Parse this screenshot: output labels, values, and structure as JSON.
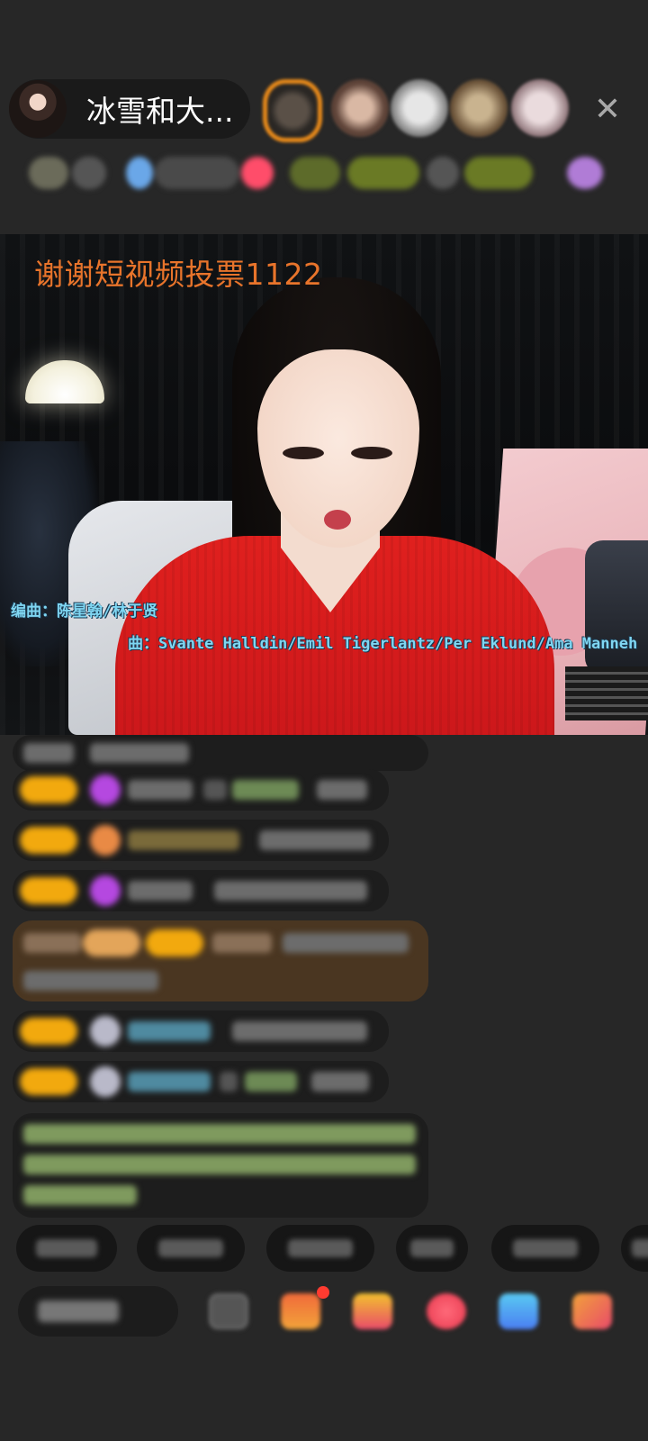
{
  "header": {
    "host_name": "冰雪和大...",
    "close_icon": "close-icon",
    "viewer_count_visible": 5
  },
  "video": {
    "overlay_title": "谢谢短视频投票1122",
    "lyric_line_1": "编曲：陈星翰/林于贤",
    "lyric_line_2": "曲：Svante Halldin/Emil Tigerlantz/Per Eklund/Ama Manneh"
  },
  "chat": {
    "messages_count": 9
  },
  "actions": {
    "quick_chips_count": 6,
    "bottom_icons": [
      "emoji-icon",
      "gift-box-icon",
      "gift-icon",
      "lucky-bag-icon",
      "game-icon",
      "more-icon"
    ]
  },
  "colors": {
    "background": "#272727",
    "overlay_title": "#e8742b",
    "lyric": "#7fd6f2",
    "level_badge": "#f2a90e"
  }
}
